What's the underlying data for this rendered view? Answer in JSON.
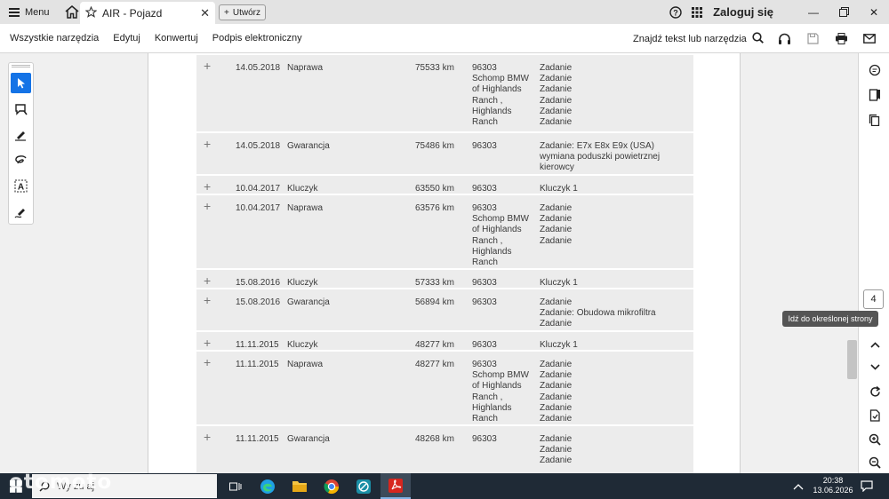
{
  "tabbar": {
    "menu_label": "Menu",
    "tab_title": "AIR - Pojazd",
    "new_tab_label": "Utwórz",
    "login_label": "Zaloguj się"
  },
  "toolbar": {
    "menus": [
      "Wszystkie narzędzia",
      "Edytuj",
      "Konwertuj",
      "Podpis elektroniczny"
    ],
    "find_label": "Znajdź tekst lub narzędzia"
  },
  "rows": [
    {
      "date": "14.05.2018",
      "type": "Naprawa",
      "km": "75533 km",
      "code": [
        "96303",
        "Schomp BMW",
        "of Highlands",
        "Ranch ,",
        "Highlands",
        "Ranch"
      ],
      "desc": [
        "Zadanie",
        "Zadanie",
        "Zadanie",
        "Zadanie",
        "Zadanie",
        "Zadanie"
      ]
    },
    {
      "date": "14.05.2018",
      "type": "Gwarancja",
      "km": "75486 km",
      "code": [
        "96303"
      ],
      "desc": [
        "Zadanie: E7x E8x E9x (USA)",
        "wymiana poduszki powietrznej",
        "kierowcy"
      ]
    },
    {
      "date": "10.04.2017",
      "type": "Kluczyk",
      "km": "63550 km",
      "code": [
        "96303"
      ],
      "desc": [
        "Kluczyk 1"
      ]
    },
    {
      "date": "10.04.2017",
      "type": "Naprawa",
      "km": "63576 km",
      "code": [
        "96303",
        "Schomp BMW",
        "of Highlands",
        "Ranch ,",
        "Highlands",
        "Ranch"
      ],
      "desc": [
        "Zadanie",
        "Zadanie",
        "Zadanie",
        "Zadanie"
      ]
    },
    {
      "date": "15.08.2016",
      "type": "Kluczyk",
      "km": "57333 km",
      "code": [
        "96303"
      ],
      "desc": [
        "Kluczyk 1"
      ]
    },
    {
      "date": "15.08.2016",
      "type": "Gwarancja",
      "km": "56894 km",
      "code": [
        "96303"
      ],
      "desc": [
        "Zadanie",
        "Zadanie: Obudowa mikrofiltra",
        "Zadanie"
      ]
    },
    {
      "date": "11.11.2015",
      "type": "Kluczyk",
      "km": "48277 km",
      "code": [
        "96303"
      ],
      "desc": [
        "Kluczyk 1"
      ]
    },
    {
      "date": "11.11.2015",
      "type": "Naprawa",
      "km": "48277 km",
      "code": [
        "96303",
        "Schomp BMW",
        "of Highlands",
        "Ranch ,",
        "Highlands",
        "Ranch"
      ],
      "desc": [
        "Zadanie",
        "Zadanie",
        "Zadanie",
        "Zadanie",
        "Zadanie",
        "Zadanie"
      ]
    },
    {
      "date": "11.11.2015",
      "type": "Gwarancja",
      "km": "48268 km",
      "code": [
        "96303"
      ],
      "desc": [
        "Zadanie",
        "Zadanie",
        "Zadanie"
      ]
    }
  ],
  "navigation": {
    "page_number": "4",
    "tooltip": "Idź do określonej strony"
  },
  "taskbar": {
    "search_placeholder": "Wy zu aj",
    "time": "20:38",
    "date": "13.06.2026"
  },
  "watermark": "otomoto",
  "colors": {
    "accent": "#1473e6",
    "row_bg": "#ececec",
    "taskbar": "#1f2a36",
    "acrobat_red": "#d7261e"
  }
}
